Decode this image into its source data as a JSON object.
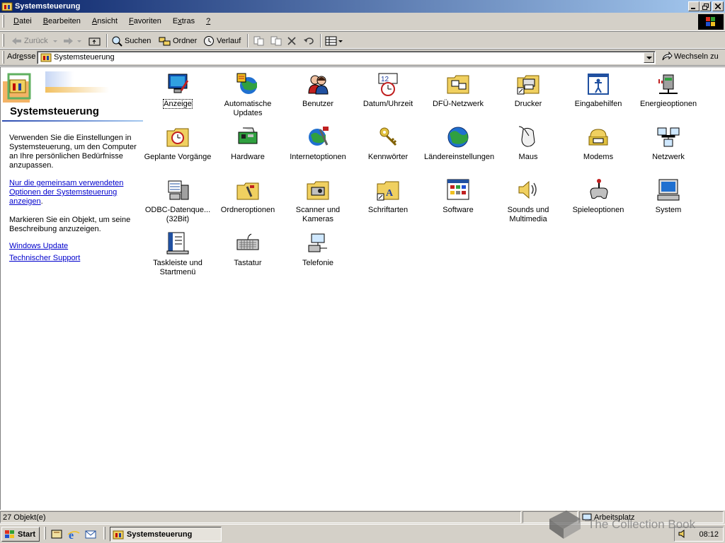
{
  "window": {
    "title": "Systemsteuerung"
  },
  "menu": {
    "items": [
      {
        "pre": "",
        "u": "D",
        "post": "atei"
      },
      {
        "pre": "",
        "u": "B",
        "post": "earbeiten"
      },
      {
        "pre": "",
        "u": "A",
        "post": "nsicht"
      },
      {
        "pre": "",
        "u": "F",
        "post": "avoriten"
      },
      {
        "pre": "E",
        "u": "x",
        "post": "tras"
      },
      {
        "pre": "",
        "u": "?",
        "post": ""
      }
    ]
  },
  "toolbar": {
    "back_label": "Zurück",
    "search_label": "Suchen",
    "folders_label": "Ordner",
    "history_label": "Verlauf"
  },
  "address": {
    "label_pre": "Adr",
    "label_u": "e",
    "label_post": "sse",
    "value": "Systemsteuerung",
    "go_label": "Wechseln zu"
  },
  "left_pane": {
    "title": "Systemsteuerung",
    "description": "Verwenden Sie die Einstellungen in Systemsteuerung, um den Computer an Ihre persönlichen Bedürfnisse anzupassen.",
    "shared_options_link": "Nur die gemeinsam verwendeten Optionen der Systemsteuerung anzeigen",
    "shared_options_suffix": ".",
    "hint": "Markieren Sie ein Objekt, um seine Beschreibung anzuzeigen.",
    "windows_update_link": "Windows Update",
    "support_link": "Technischer Support"
  },
  "items": [
    "Anzeige",
    "Automatische Updates",
    "Benutzer",
    "Datum/Uhrzeit",
    "DFÜ-Netzwerk",
    "Drucker",
    "Eingabehilfen",
    "Energieoptionen",
    "Geplante Vorgänge",
    "Hardware",
    "Internetoptionen",
    "Kennwörter",
    "Ländereinstellungen",
    "Maus",
    "Modems",
    "Netzwerk",
    "ODBC-Datenque... (32Bit)",
    "Ordneroptionen",
    "Scanner und Kameras",
    "Schriftarten",
    "Software",
    "Sounds und Multimedia",
    "Spieleoptionen",
    "System",
    "Taskleiste und Startmenü",
    "Tastatur",
    "Telefonie"
  ],
  "icons": [
    "display-icon",
    "windows-update-icon",
    "users-icon",
    "date-time-icon",
    "dialup-network-icon",
    "printers-icon",
    "accessibility-icon",
    "power-options-icon",
    "scheduled-tasks-icon",
    "hardware-icon",
    "internet-options-icon",
    "passwords-icon",
    "regional-settings-icon",
    "mouse-icon",
    "modems-icon",
    "network-icon",
    "odbc-icon",
    "folder-options-icon",
    "scanners-cameras-icon",
    "fonts-icon",
    "software-icon",
    "sounds-multimedia-icon",
    "game-controllers-icon",
    "system-icon",
    "taskbar-startmenu-icon",
    "keyboard-icon",
    "telephony-icon"
  ],
  "status": {
    "count": "27 Objekt(e)",
    "zone": "Arbeitsplatz"
  },
  "taskbar": {
    "start_label": "Start",
    "task_label": "Systemsteuerung",
    "clock": "08:12"
  },
  "watermark": "The Collection Book",
  "colors": {
    "title_gradient_start": "#0a246a",
    "title_gradient_end": "#a6caf0",
    "face": "#d4d0c8",
    "link": "#0000cc"
  }
}
